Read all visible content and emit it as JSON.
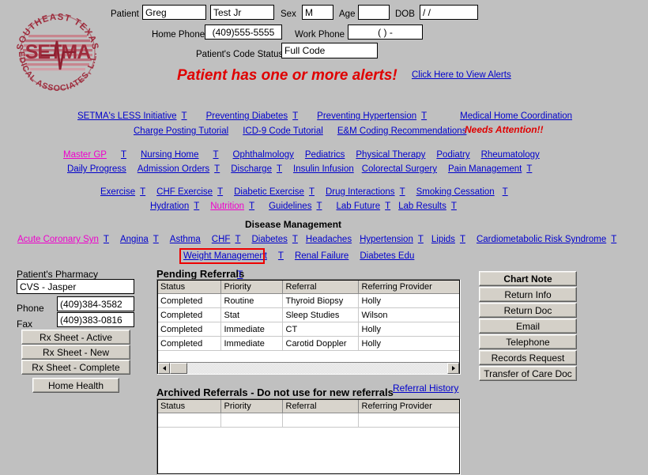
{
  "logo": {
    "top_arc_text": "SOUTHEAST TEXAS",
    "bottom_arc_text": "MEDICAL ASSOCIATES, L.L.P.",
    "center_text": "SETMA",
    "color": "#9e2b3c"
  },
  "patient": {
    "label": "Patient",
    "first_name": "Greg",
    "last_name": "Test Jr",
    "sex_label": "Sex",
    "sex": "M",
    "age_label": "Age",
    "age": "",
    "dob_label": "DOB",
    "dob": "/  /",
    "home_phone_label": "Home Phone",
    "home_phone": "(409)555-5555",
    "work_phone_label": "Work Phone",
    "work_phone": "(   )    -",
    "code_status_label": "Patient's Code Status",
    "code_status": "Full Code"
  },
  "alert": {
    "banner": "Patient has one or more alerts!",
    "link": "Click Here to View Alerts",
    "color": "#e00000"
  },
  "nav_row1": [
    {
      "label": "SETMA's LESS Initiative",
      "t": true,
      "visited": false
    },
    {
      "label": "Preventing Diabetes",
      "t": true,
      "visited": false
    },
    {
      "label": "Preventing Hypertension",
      "t": true,
      "visited": false
    },
    {
      "label": "Medical Home Coordination",
      "t": false,
      "visited": false
    }
  ],
  "nav_row2": [
    {
      "label": "Charge Posting Tutorial",
      "t": false,
      "visited": false
    },
    {
      "label": "ICD-9 Code Tutorial",
      "t": false,
      "visited": false
    },
    {
      "label": "E&M Coding Recommendations",
      "t": false,
      "visited": false
    }
  ],
  "needs_attention": "Needs Attention!!",
  "nav_row3": [
    {
      "label": "Master GP",
      "t": true,
      "visited": true
    },
    {
      "label": "Nursing Home",
      "t": true,
      "visited": false
    },
    {
      "label": "Ophthalmology",
      "t": false,
      "visited": false
    },
    {
      "label": "Pediatrics",
      "t": false,
      "visited": false
    },
    {
      "label": "Physical Therapy",
      "t": false,
      "visited": false
    },
    {
      "label": "Podiatry",
      "t": false,
      "visited": false
    },
    {
      "label": "Rheumatology",
      "t": false,
      "visited": false
    }
  ],
  "nav_row4": [
    {
      "label": "Daily Progress",
      "t": false,
      "visited": false
    },
    {
      "label": "Admission Orders",
      "t": true,
      "visited": false
    },
    {
      "label": "Discharge",
      "t": true,
      "visited": false
    },
    {
      "label": "Insulin Infusion",
      "t": false,
      "visited": false
    },
    {
      "label": "Colorectal Surgery",
      "t": false,
      "visited": false
    },
    {
      "label": "Pain Management",
      "t": true,
      "visited": false
    }
  ],
  "nav_row5": [
    {
      "label": "Exercise",
      "t": true,
      "visited": false
    },
    {
      "label": "CHF Exercise",
      "t": true,
      "visited": false
    },
    {
      "label": "Diabetic Exercise",
      "t": true,
      "visited": false
    },
    {
      "label": "Drug Interactions",
      "t": true,
      "visited": false
    },
    {
      "label": "Smoking Cessation",
      "t": true,
      "visited": false
    }
  ],
  "nav_row6": [
    {
      "label": "Hydration",
      "t": true,
      "visited": false
    },
    {
      "label": "Nutrition",
      "t": true,
      "visited": true
    },
    {
      "label": "Guidelines",
      "t": true,
      "visited": false
    },
    {
      "label": "Lab Future",
      "t": true,
      "visited": false
    },
    {
      "label": "Lab Results",
      "t": true,
      "visited": false
    }
  ],
  "disease_management": {
    "heading": "Disease Management",
    "row1": [
      {
        "label": "Acute Coronary Syn",
        "t": true,
        "visited": true
      },
      {
        "label": "Angina",
        "t": true,
        "visited": false
      },
      {
        "label": "Asthma",
        "t": false,
        "visited": false
      },
      {
        "label": "CHF",
        "t": true,
        "visited": false
      },
      {
        "label": "Diabetes",
        "t": true,
        "visited": false
      },
      {
        "label": "Headaches",
        "t": false,
        "visited": false
      },
      {
        "label": "Hypertension",
        "t": true,
        "visited": false
      },
      {
        "label": "Lipids",
        "t": true,
        "visited": false
      },
      {
        "label": "Cardiometabolic Risk Syndrome",
        "t": true,
        "visited": false
      }
    ],
    "row2": [
      {
        "label": "Weight Management",
        "t": true,
        "visited": false,
        "highlighted": true
      },
      {
        "label": "Renal Failure",
        "t": false,
        "visited": false
      },
      {
        "label": "Diabetes Edu",
        "t": false,
        "visited": false
      }
    ]
  },
  "pharmacy": {
    "heading": "Patient's Pharmacy",
    "name": "CVS - Jasper",
    "phone_label": "Phone",
    "phone": "(409)384-3582",
    "fax_label": "Fax",
    "fax": "(409)383-0816",
    "buttons": [
      "Rx Sheet - Active",
      "Rx Sheet - New",
      "Rx Sheet - Complete"
    ],
    "home_health_button": "Home Health"
  },
  "pending_referrals": {
    "heading": "Pending Referrals",
    "t": "T",
    "columns": [
      "Status",
      "Priority",
      "Referral",
      "Referring Provider"
    ],
    "rows": [
      [
        "Completed",
        "Routine",
        "Thyroid Biopsy",
        "Holly"
      ],
      [
        "Completed",
        "Stat",
        "Sleep Studies",
        "Wilson"
      ],
      [
        "Completed",
        "Immediate",
        "CT",
        "Holly"
      ],
      [
        "Completed",
        "Immediate",
        "Carotid Doppler",
        "Holly"
      ]
    ]
  },
  "archived_referrals": {
    "heading": "Archived Referrals - Do not use for new referrals",
    "history_link": "Referral History",
    "columns": [
      "Status",
      "Priority",
      "Referral",
      "Referring Provider"
    ],
    "rows": [
      [
        "",
        "",
        "",
        ""
      ]
    ]
  },
  "action_buttons": [
    {
      "label": "Chart Note",
      "bold": true
    },
    {
      "label": "Return Info",
      "bold": false
    },
    {
      "label": "Return Doc",
      "bold": false
    },
    {
      "label": "Email",
      "bold": false
    },
    {
      "label": "Telephone",
      "bold": false
    },
    {
      "label": "Records Request",
      "bold": false
    },
    {
      "label": "Transfer of Care Doc",
      "bold": false
    }
  ]
}
